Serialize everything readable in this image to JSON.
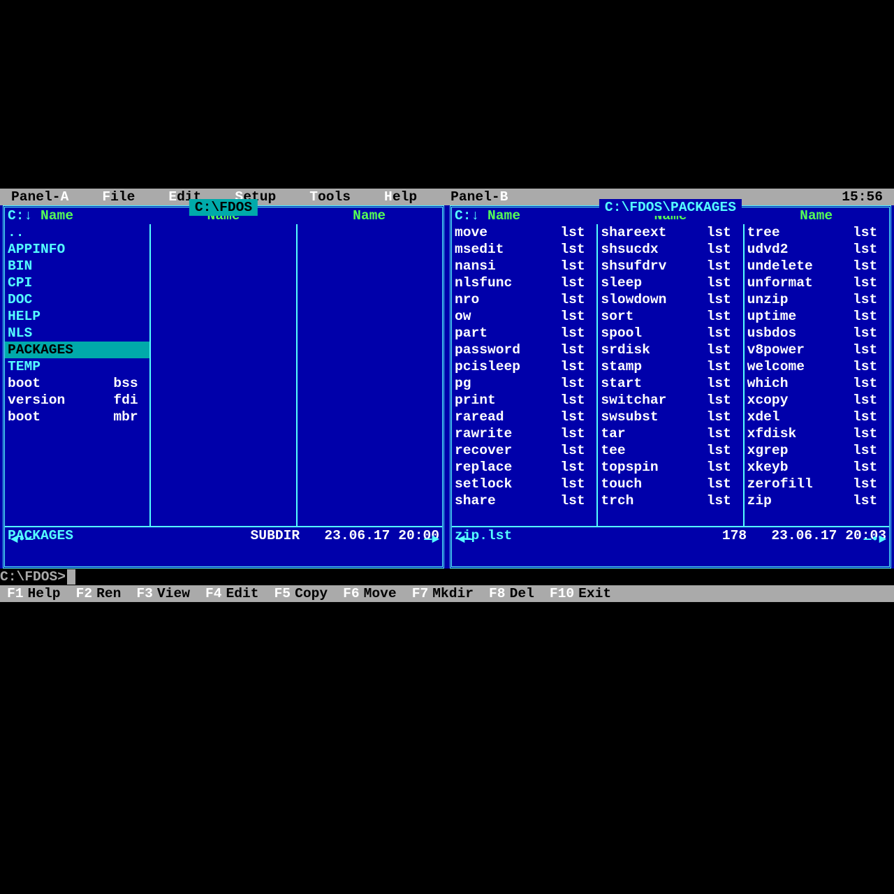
{
  "clock": "15:56",
  "menubar": [
    {
      "pre": "Panel-",
      "hk": "A",
      "post": ""
    },
    {
      "pre": "",
      "hk": "F",
      "post": "ile"
    },
    {
      "pre": "",
      "hk": "E",
      "post": "dit"
    },
    {
      "pre": "",
      "hk": "S",
      "post": "etup"
    },
    {
      "pre": "",
      "hk": "T",
      "post": "ools"
    },
    {
      "pre": "",
      "hk": "H",
      "post": "elp"
    },
    {
      "pre": "Panel-",
      "hk": "B",
      "post": ""
    }
  ],
  "panelA": {
    "title": " C:\\FDOS ",
    "active": true,
    "sortLabel": "C:↓",
    "headers": [
      "Name",
      "Name",
      "Name"
    ],
    "cols": [
      [
        {
          "name": "..",
          "ext": "",
          "type": "dir"
        },
        {
          "name": "APPINFO",
          "ext": "",
          "type": "dir"
        },
        {
          "name": "BIN",
          "ext": "",
          "type": "dir"
        },
        {
          "name": "CPI",
          "ext": "",
          "type": "dir"
        },
        {
          "name": "DOC",
          "ext": "",
          "type": "dir"
        },
        {
          "name": "HELP",
          "ext": "",
          "type": "dir"
        },
        {
          "name": "NLS",
          "ext": "",
          "type": "dir"
        },
        {
          "name": "PACKAGES",
          "ext": "",
          "type": "dir",
          "selected": true
        },
        {
          "name": "TEMP",
          "ext": "",
          "type": "dir"
        },
        {
          "name": "boot",
          "ext": "bss",
          "type": "file"
        },
        {
          "name": "version",
          "ext": "fdi",
          "type": "file"
        },
        {
          "name": "boot",
          "ext": "mbr",
          "type": "file"
        }
      ],
      [],
      []
    ],
    "footer": {
      "name": "PACKAGES",
      "info": "SUBDIR   23.06.17 20:00"
    }
  },
  "panelB": {
    "title": " C:\\FDOS\\PACKAGES ",
    "active": false,
    "sortLabel": "C:↓",
    "headers": [
      "Name",
      "Name",
      "Name"
    ],
    "cols": [
      [
        {
          "name": "move",
          "ext": "lst",
          "type": "file"
        },
        {
          "name": "msedit",
          "ext": "lst",
          "type": "file"
        },
        {
          "name": "nansi",
          "ext": "lst",
          "type": "file"
        },
        {
          "name": "nlsfunc",
          "ext": "lst",
          "type": "file"
        },
        {
          "name": "nro",
          "ext": "lst",
          "type": "file"
        },
        {
          "name": "ow",
          "ext": "lst",
          "type": "file"
        },
        {
          "name": "part",
          "ext": "lst",
          "type": "file"
        },
        {
          "name": "password",
          "ext": "lst",
          "type": "file"
        },
        {
          "name": "pcisleep",
          "ext": "lst",
          "type": "file"
        },
        {
          "name": "pg",
          "ext": "lst",
          "type": "file"
        },
        {
          "name": "print",
          "ext": "lst",
          "type": "file"
        },
        {
          "name": "raread",
          "ext": "lst",
          "type": "file"
        },
        {
          "name": "rawrite",
          "ext": "lst",
          "type": "file"
        },
        {
          "name": "recover",
          "ext": "lst",
          "type": "file"
        },
        {
          "name": "replace",
          "ext": "lst",
          "type": "file"
        },
        {
          "name": "setlock",
          "ext": "lst",
          "type": "file"
        },
        {
          "name": "share",
          "ext": "lst",
          "type": "file"
        }
      ],
      [
        {
          "name": "shareext",
          "ext": "lst",
          "type": "file"
        },
        {
          "name": "shsucdx",
          "ext": "lst",
          "type": "file"
        },
        {
          "name": "shsufdrv",
          "ext": "lst",
          "type": "file"
        },
        {
          "name": "sleep",
          "ext": "lst",
          "type": "file"
        },
        {
          "name": "slowdown",
          "ext": "lst",
          "type": "file"
        },
        {
          "name": "sort",
          "ext": "lst",
          "type": "file"
        },
        {
          "name": "spool",
          "ext": "lst",
          "type": "file"
        },
        {
          "name": "srdisk",
          "ext": "lst",
          "type": "file"
        },
        {
          "name": "stamp",
          "ext": "lst",
          "type": "file"
        },
        {
          "name": "start",
          "ext": "lst",
          "type": "file"
        },
        {
          "name": "switchar",
          "ext": "lst",
          "type": "file"
        },
        {
          "name": "swsubst",
          "ext": "lst",
          "type": "file"
        },
        {
          "name": "tar",
          "ext": "lst",
          "type": "file"
        },
        {
          "name": "tee",
          "ext": "lst",
          "type": "file"
        },
        {
          "name": "topspin",
          "ext": "lst",
          "type": "file"
        },
        {
          "name": "touch",
          "ext": "lst",
          "type": "file"
        },
        {
          "name": "trch",
          "ext": "lst",
          "type": "file"
        }
      ],
      [
        {
          "name": "tree",
          "ext": "lst",
          "type": "file"
        },
        {
          "name": "udvd2",
          "ext": "lst",
          "type": "file"
        },
        {
          "name": "undelete",
          "ext": "lst",
          "type": "file"
        },
        {
          "name": "unformat",
          "ext": "lst",
          "type": "file"
        },
        {
          "name": "unzip",
          "ext": "lst",
          "type": "file"
        },
        {
          "name": "uptime",
          "ext": "lst",
          "type": "file"
        },
        {
          "name": "usbdos",
          "ext": "lst",
          "type": "file"
        },
        {
          "name": "v8power",
          "ext": "lst",
          "type": "file"
        },
        {
          "name": "welcome",
          "ext": "lst",
          "type": "file"
        },
        {
          "name": "which",
          "ext": "lst",
          "type": "file"
        },
        {
          "name": "xcopy",
          "ext": "lst",
          "type": "file"
        },
        {
          "name": "xdel",
          "ext": "lst",
          "type": "file"
        },
        {
          "name": "xfdisk",
          "ext": "lst",
          "type": "file"
        },
        {
          "name": "xgrep",
          "ext": "lst",
          "type": "file"
        },
        {
          "name": "xkeyb",
          "ext": "lst",
          "type": "file"
        },
        {
          "name": "zerofill",
          "ext": "lst",
          "type": "file"
        },
        {
          "name": "zip",
          "ext": "lst",
          "type": "file"
        }
      ]
    ],
    "footer": {
      "name": "zip.lst",
      "info": "178   23.06.17 20:03"
    }
  },
  "prompt": "C:\\FDOS>",
  "fnkeys": [
    {
      "key": "F1",
      "label": "Help"
    },
    {
      "key": "F2",
      "label": "Ren"
    },
    {
      "key": "F3",
      "label": "View"
    },
    {
      "key": "F4",
      "label": "Edit"
    },
    {
      "key": "F5",
      "label": "Copy"
    },
    {
      "key": "F6",
      "label": "Move"
    },
    {
      "key": "F7",
      "label": "Mkdir"
    },
    {
      "key": "F8",
      "label": "Del"
    },
    {
      "key": "F10",
      "label": "Exit"
    }
  ]
}
